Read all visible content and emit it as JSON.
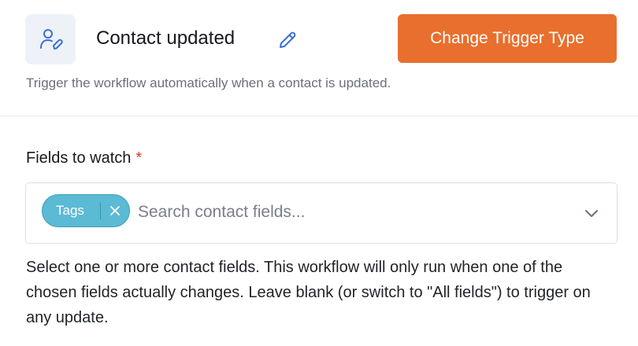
{
  "trigger": {
    "icon": "contact-edit-icon",
    "title": "Contact updated",
    "edit_icon": "pencil-icon",
    "change_button_label": "Change Trigger Type",
    "description": "Trigger the workflow automatically when a contact is updated."
  },
  "fields_to_watch": {
    "label": "Fields to watch",
    "required_marker": "*",
    "selected_tags": [
      {
        "label": "Tags",
        "remove_icon": "close-icon"
      }
    ],
    "search_value": "",
    "search_placeholder": "Search contact fields...",
    "dropdown_icon": "chevron-down-icon",
    "help_text": "Select one or more contact fields. This workflow will only run when one of the chosen fields actually changes. Leave blank (or switch to \"All fields\") to trigger on any update."
  },
  "colors": {
    "accent_button": "#e86f2d",
    "tag_background": "#5bbad4",
    "icon_blue": "#3a6fd8",
    "required_red": "#d43b2a"
  }
}
